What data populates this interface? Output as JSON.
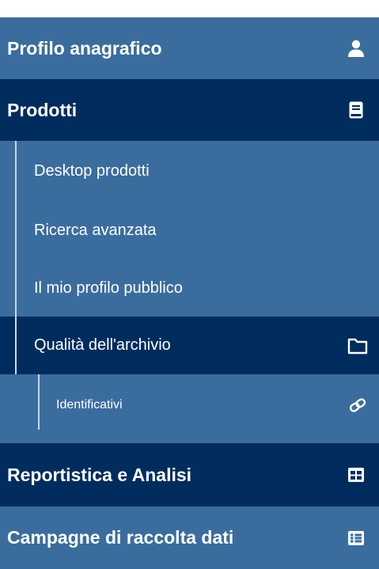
{
  "menu": {
    "profilo": {
      "label": "Profilo anagrafico",
      "icon": "user-icon"
    },
    "prodotti": {
      "label": "Prodotti",
      "icon": "book-icon",
      "items": [
        {
          "label": "Desktop prodotti"
        },
        {
          "label": "Ricerca avanzata"
        },
        {
          "label": "Il mio profilo pubblico"
        },
        {
          "label": "Qualità dell'archivio",
          "icon": "folder-icon",
          "items": [
            {
              "label": "Identificativi",
              "icon": "link-icon"
            }
          ]
        }
      ]
    },
    "reportistica": {
      "label": "Reportistica e Analisi",
      "icon": "table-icon"
    },
    "campagne": {
      "label": "Campagne di raccolta dati",
      "icon": "list-icon"
    }
  },
  "colors": {
    "nav_bg": "#3a6d9e",
    "active_bg": "#002d5e",
    "text": "#ffffff",
    "tree_line": "#c9d8e6"
  }
}
